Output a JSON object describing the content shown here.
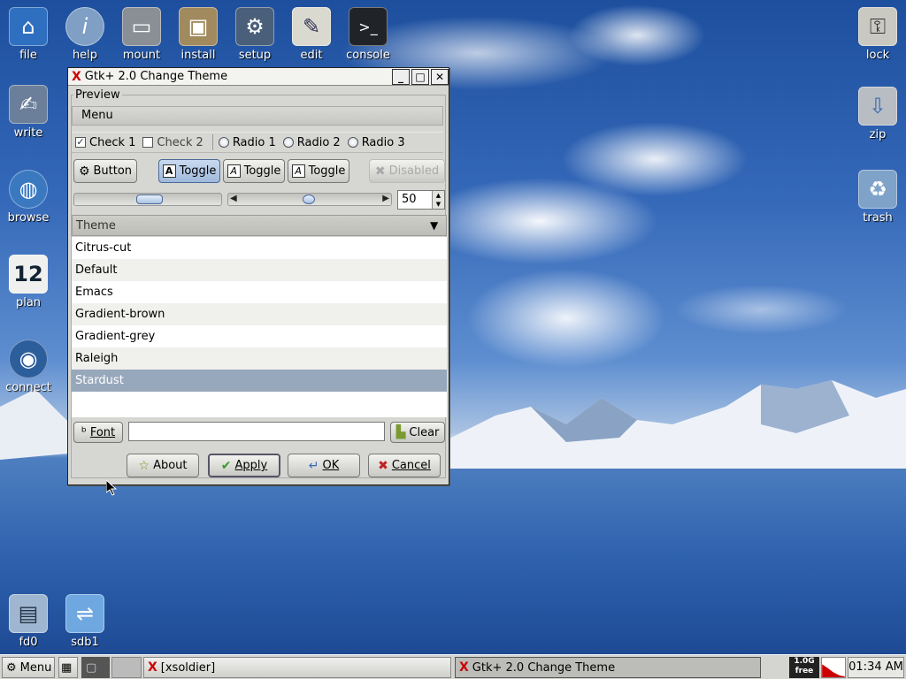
{
  "desktop": {
    "icons_top": [
      {
        "label": "file",
        "icon": "house-icon",
        "color": "#2f6fbf",
        "glyph": "⌂"
      },
      {
        "label": "help",
        "icon": "info-icon",
        "color": "#7f9fc4",
        "glyph": "i"
      },
      {
        "label": "mount",
        "icon": "drive-icon",
        "color": "#8a8f96",
        "glyph": "▭"
      },
      {
        "label": "install",
        "icon": "package-icon",
        "color": "#a08a5e",
        "glyph": "▣"
      },
      {
        "label": "setup",
        "icon": "setup-icon",
        "color": "#4a5f7a",
        "glyph": "⚙"
      },
      {
        "label": "edit",
        "icon": "pen-icon",
        "color": "#d9d9d0",
        "glyph": "✎"
      },
      {
        "label": "console",
        "icon": "terminal-icon",
        "color": "#202428",
        "glyph": ">_"
      }
    ],
    "icons_left": [
      {
        "label": "write",
        "icon": "write-icon",
        "color": "#6c7f9a",
        "glyph": "✍"
      },
      {
        "label": "browse",
        "icon": "globe-icon",
        "color": "#3a78c0",
        "glyph": "◍"
      },
      {
        "label": "plan",
        "icon": "calendar-icon",
        "color": "#f0f0ee",
        "glyph": "12"
      },
      {
        "label": "connect",
        "icon": "connect-icon",
        "color": "#2d5e9c",
        "glyph": "◉"
      }
    ],
    "icons_right": [
      {
        "label": "lock",
        "icon": "lock-icon",
        "color": "#c9c9c2",
        "glyph": "🔒"
      },
      {
        "label": "zip",
        "icon": "zip-icon",
        "color": "#b8bdc4",
        "glyph": "⇩"
      },
      {
        "label": "trash",
        "icon": "trash-icon",
        "color": "#7fa2c8",
        "glyph": "🗑"
      }
    ],
    "icons_bottom": [
      {
        "label": "fd0",
        "icon": "floppy-icon",
        "color": "#9fb6d0",
        "glyph": "▤"
      },
      {
        "label": "sdb1",
        "icon": "usb-icon",
        "color": "#6fa8e0",
        "glyph": "⇌"
      }
    ]
  },
  "window": {
    "title": "Gtk+ 2.0 Change Theme",
    "preview_label": "Preview",
    "menu_label": "Menu",
    "checks": [
      {
        "label": "Check 1",
        "checked": true
      },
      {
        "label": "Check 2",
        "checked": false
      }
    ],
    "radios": [
      "Radio 1",
      "Radio 2",
      "Radio 3"
    ],
    "button_label": "Button",
    "toggles": [
      "Toggle",
      "Toggle",
      "Toggle"
    ],
    "disabled_label": "Disabled",
    "spin_value": "50",
    "list_header": "Theme",
    "themes": [
      "Citrus-cut",
      "Default",
      "Emacs",
      "Gradient-brown",
      "Gradient-grey",
      "Raleigh",
      "Stardust"
    ],
    "selected_theme": "Stardust",
    "font_label": "Font",
    "font_value": "",
    "clear_label": "Clear",
    "about_label": "About",
    "apply_label": "Apply",
    "ok_label": "OK",
    "cancel_label": "Cancel"
  },
  "taskbar": {
    "menu_label": "Menu",
    "tasks": [
      "[xsoldier]",
      "Gtk+ 2.0 Change Theme"
    ],
    "mem_top": "1.0G",
    "mem_bottom": "free",
    "clock": "01:34 AM"
  },
  "colors": {
    "selection": "#98a8bc",
    "active_toggle": "#a9c2e2",
    "close_x": "#cc0000"
  }
}
